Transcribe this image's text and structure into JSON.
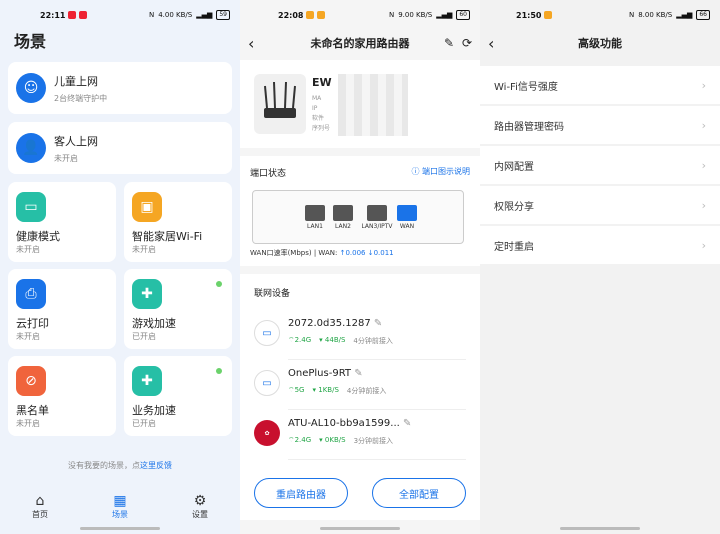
{
  "panel1": {
    "status": {
      "time": "22:11",
      "net": "4.00 KB/S",
      "battery": "59"
    },
    "title": "场景",
    "wide_cards": [
      {
        "title": "儿童上网",
        "sub": "2台终端守护中"
      },
      {
        "title": "客人上网",
        "sub": "未开启"
      }
    ],
    "grid_cards": [
      {
        "title": "健康模式",
        "sub": "未开启",
        "color": "#26bfa6",
        "icon": "monitor-icon",
        "dot": false
      },
      {
        "title": "智能家居Wi-Fi",
        "sub": "未开启",
        "color": "#f5a623",
        "icon": "speaker-icon",
        "dot": false
      },
      {
        "title": "云打印",
        "sub": "未开启",
        "color": "#1a73e8",
        "icon": "printer-icon",
        "dot": false
      },
      {
        "title": "游戏加速",
        "sub": "已开启",
        "color": "#26bfa6",
        "icon": "gamepad-icon",
        "dot": true
      },
      {
        "title": "黑名单",
        "sub": "未开启",
        "color": "#f0643c",
        "icon": "block-user-icon",
        "dot": false
      },
      {
        "title": "业务加速",
        "sub": "已开启",
        "color": "#26bfa6",
        "icon": "gamepad-icon",
        "dot": true
      }
    ],
    "feedback": {
      "prefix": "没有我要的场景，点",
      "link": "这里反馈"
    },
    "tabs": [
      {
        "label": "首页",
        "icon": "home-icon",
        "active": false
      },
      {
        "label": "场景",
        "icon": "grid-icon",
        "active": true
      },
      {
        "label": "设置",
        "icon": "gear-icon",
        "active": false
      }
    ]
  },
  "panel2": {
    "status": {
      "time": "22:08",
      "net": "9.00 KB/S",
      "battery": "60"
    },
    "title": "未命名的家用路由器",
    "device": {
      "name_prefix": "EW",
      "line_ip": "IP",
      "line_sw": "软件",
      "line_sn": "序列号"
    },
    "ports": {
      "title": "端口状态",
      "help": "端口图示说明",
      "labels": [
        "LAN1",
        "LAN2",
        "LAN3/IPTV",
        "WAN"
      ],
      "rate_label": "WAN口速率(Mbps) | WAN:",
      "up": "↑0.006",
      "down": "↓0.011"
    },
    "devices_title": "联网设备",
    "devices": [
      {
        "name": "2072.0d35.1287",
        "band": "2.4G",
        "speed": "44B/S",
        "time": "4分钟前接入",
        "icon": "laptop-icon"
      },
      {
        "name": "OnePlus-9RT",
        "band": "5G",
        "speed": "1KB/S",
        "time": "4分钟前接入",
        "icon": "laptop-icon"
      },
      {
        "name": "ATU-AL10-bb9a1599...",
        "band": "2.4G",
        "speed": "0KB/S",
        "time": "3分钟前接入",
        "icon": "huawei-icon"
      }
    ],
    "buttons": {
      "restart": "重启路由器",
      "all_config": "全部配置"
    }
  },
  "panel3": {
    "status": {
      "time": "21:50",
      "net": "8.00 KB/S",
      "battery": "66"
    },
    "title": "高级功能",
    "items": [
      "Wi-Fi信号强度",
      "路由器管理密码",
      "内网配置",
      "权限分享",
      "定时重启"
    ]
  }
}
